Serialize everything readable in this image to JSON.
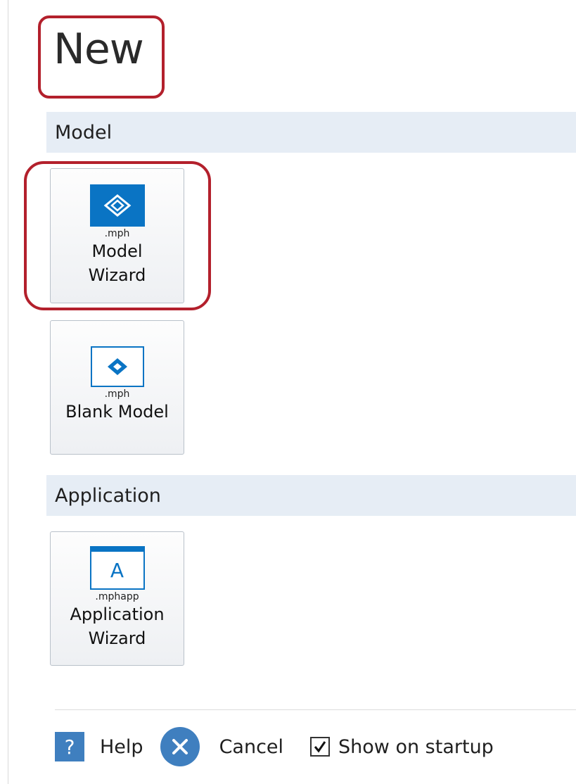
{
  "page": {
    "title": "New"
  },
  "sections": {
    "model": {
      "header": "Model",
      "tiles": [
        {
          "ext": ".mph",
          "label_line1": "Model",
          "label_line2": "Wizard",
          "icon": "model-wizard-icon"
        },
        {
          "ext": ".mph",
          "label_line1": "Blank Model",
          "icon": "blank-model-icon"
        }
      ]
    },
    "application": {
      "header": "Application",
      "tiles": [
        {
          "ext": ".mphapp",
          "icon_letter": "A",
          "label_line1": "Application",
          "label_line2": "Wizard",
          "icon": "application-wizard-icon"
        }
      ]
    }
  },
  "footer": {
    "help_icon_glyph": "?",
    "help_label": "Help",
    "cancel_label": "Cancel",
    "show_on_startup_label": "Show on startup",
    "show_on_startup_checked": true
  },
  "colors": {
    "accent_blue": "#0a74c4",
    "section_bg": "#e6edf5",
    "highlight_red": "#b3202c",
    "footer_icon_blue": "#3f7fbf"
  }
}
